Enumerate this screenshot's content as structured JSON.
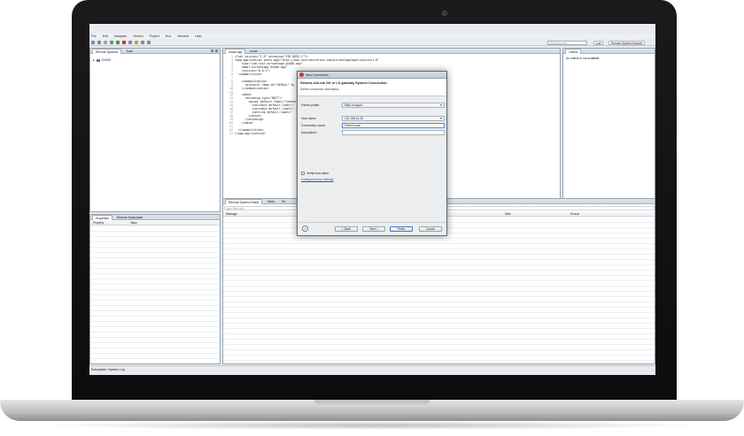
{
  "menu": [
    "File",
    "Edit",
    "Navigate",
    "Search",
    "Project",
    "Run",
    "Window",
    "Help"
  ],
  "toolbar": {
    "quick_access_placeholder": "Quick Access",
    "perspectives": [
      "Lua",
      "Remote System Explorer"
    ]
  },
  "left_panel": {
    "tabs": [
      "Remote Systems",
      "Team"
    ],
    "tree": [
      {
        "label": "GX400"
      }
    ]
  },
  "editor": {
    "tabs": [
      "model.app",
      "mode"
    ],
    "lines": [
      "<?xml version=\"1.0\" encoding=\"ISO-8859-1\"?>",
      "<app:application xmlns:app=\"http://www.sierrawireless.com/airvantage/application/1.0\"",
      "    type=\"com.test.airvantage.gx400.app\"",
      "    name=\"AirVantage GX400 App\"",
      "    revision=\"0.0.1\">",
      "  <capabilities>",
      "",
      "    <communication>",
      "      <protocol comm-id=\"SERIAL\" ty",
      "    </communication>",
      "",
      "    <data>",
      "      <encoding type=\"MQTT\">",
      "        <asset default-label=\"Greenh",
      "          <variable default-label=\"",
      "          <variable default-label=\"",
      "          <setting default-label=\"",
      "        </asset>",
      "      </encoding>",
      "    </data>",
      "",
      "  </capabilities>",
      "</app:application>"
    ]
  },
  "outline": {
    "tab": "Outline",
    "message": "An outline is not available."
  },
  "properties": {
    "tabs": [
      "Properties",
      "Remote Scratchpad"
    ],
    "columns": [
      "Property",
      "Value"
    ]
  },
  "log_view": {
    "tabs": [
      "Remote System Details",
      "Tasks",
      "Ter"
    ],
    "filter_placeholder": "type filter text",
    "columns": [
      "Message",
      "Date",
      "Source"
    ]
  },
  "status_bar": "Subsystem: System Log",
  "dialog": {
    "title": "New Connection",
    "heading": "Remote AirLink GX or LS gateway System Connection",
    "subheading": "Define connection information",
    "parent_profile_label": "Parent profile:",
    "parent_profile_value": "Mike-mt-sport",
    "host_name_label": "Host name:",
    "host_name_value": "192.168.14.25",
    "connection_name_label": "Connection name:",
    "connection_name_value": "Greenhouse",
    "description_label": "Description:",
    "description_value": "",
    "verify_label": "Verify host name",
    "proxy_link": "Configure proxy settings",
    "help_glyph": "?",
    "buttons": {
      "back": "< Back",
      "next": "Next >",
      "finish": "Finish",
      "cancel": "Cancel"
    }
  },
  "colors": {
    "accent": "#3d7bd0",
    "link": "#1a5fb4",
    "dialog_logo": "#c0392b"
  }
}
